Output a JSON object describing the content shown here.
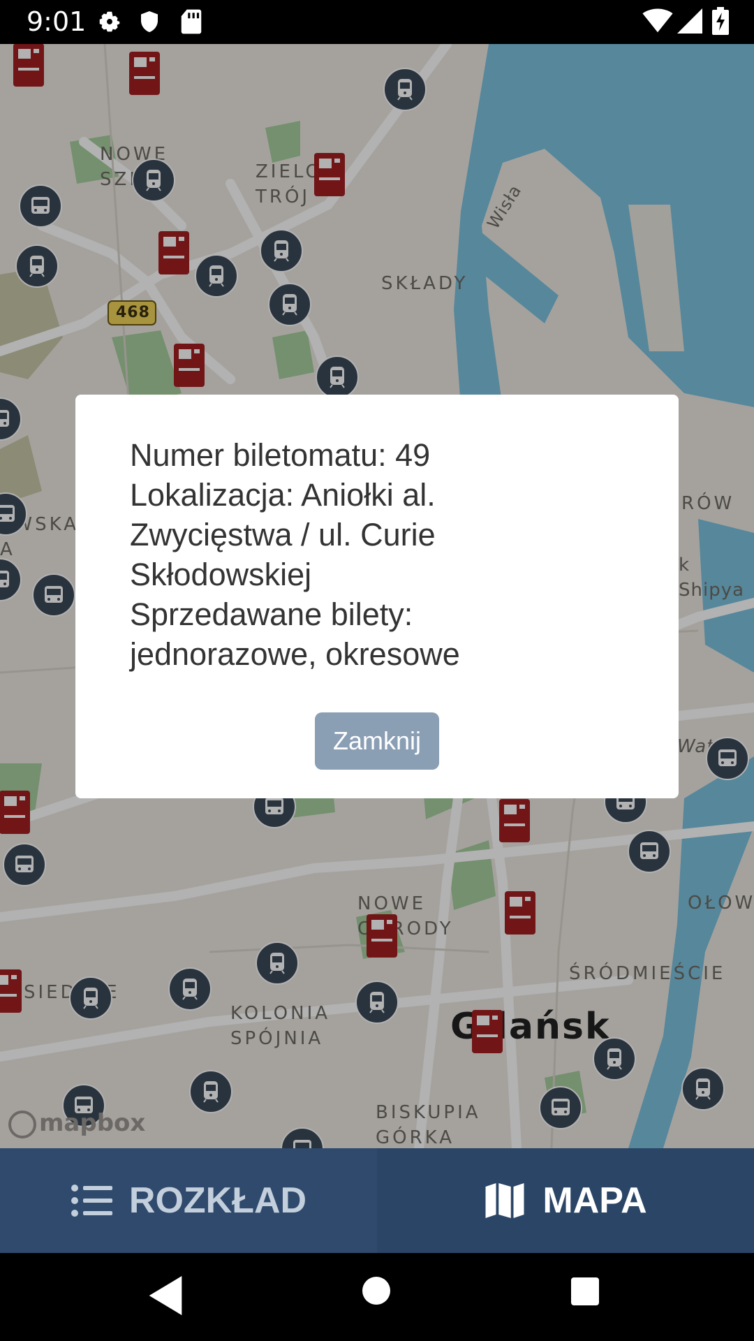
{
  "status_bar": {
    "time": "9:01",
    "left_icons": [
      "gear-icon",
      "shield-icon",
      "sd-card-icon"
    ],
    "right_icons": [
      "wifi-icon",
      "signal-icon",
      "battery-icon"
    ]
  },
  "map": {
    "labels": [
      {
        "id": "nowe-szkoty",
        "text": "NOWE\nSZK"
      },
      {
        "id": "zielony-trojkat",
        "text": "ZIELO\nTRÓJ"
      },
      {
        "id": "sklady",
        "text": "SKŁADY"
      },
      {
        "id": "wisla",
        "text": "Wisła"
      },
      {
        "id": "rod-468",
        "text": "468"
      },
      {
        "id": "row",
        "text": "RÓW"
      },
      {
        "id": "shipyard",
        "text": "k Shipya"
      },
      {
        "id": "ewska",
        "text": "EWSKA\nA"
      },
      {
        "id": "siedlce",
        "text": "SIEDLCE"
      },
      {
        "id": "nowe-ogrody",
        "text": "NOWE\nOGRODY"
      },
      {
        "id": "kolonia-spojnia",
        "text": "KOLONIA\nSPÓJNIA"
      },
      {
        "id": "srodmiescie",
        "text": "ŚRÓDMIEŚCIE"
      },
      {
        "id": "olow",
        "text": "OŁOW"
      },
      {
        "id": "gdansk",
        "text": "Gdańsk"
      },
      {
        "id": "biskupia-gorka",
        "text": "BISKUPIA\nGÓRKA"
      },
      {
        "id": "watc",
        "text": "Wato"
      }
    ],
    "attribution": "mapbox",
    "info_icon": "info-icon"
  },
  "dialog": {
    "lines": [
      "Numer biletomatu: 49",
      "Lokalizacja: Aniołki al.",
      "Zwycięstwa / ul. Curie",
      "Skłodowskiej",
      "Sprzedawane bilety:",
      "jednorazowe, okresowe"
    ],
    "close_label": "Zamknij"
  },
  "tabs": [
    {
      "label": "ROZKŁAD",
      "icon": "list-icon",
      "active": false
    },
    {
      "label": "MAPA",
      "icon": "map-icon",
      "active": true
    }
  ],
  "nav": {
    "back": "back-icon",
    "home": "home-icon",
    "recents": "recents-icon"
  },
  "colors": {
    "tab_bar": "#2f4a6c",
    "button": "#8a9eb4",
    "ticket_marker": "#a31f22",
    "transit_marker": "#3b4a5a",
    "water": "#6bb6d6"
  }
}
